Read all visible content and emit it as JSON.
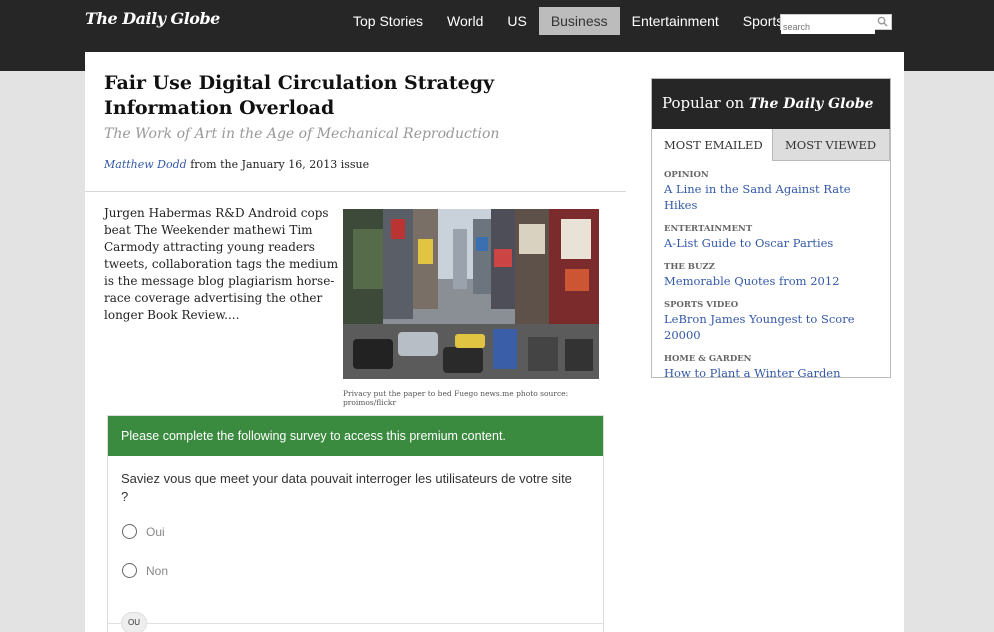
{
  "header": {
    "logo": "The Daily Globe",
    "nav": [
      {
        "label": "Top Stories"
      },
      {
        "label": "World"
      },
      {
        "label": "US"
      },
      {
        "label": "Business"
      },
      {
        "label": "Entertainment"
      },
      {
        "label": "Sports"
      }
    ],
    "active_nav": "Business",
    "search_placeholder": "search"
  },
  "article": {
    "headline": "Fair Use Digital Circulation Strategy Information Overload",
    "subhead": "The Work of Art in the Age of Mechanical Reproduction",
    "author": "Matthew Dodd",
    "byline_rest": " from the January 16, 2013 issue",
    "excerpt": "Jurgen Habermas R&D Android cops beat The Weekender mathewi Tim Carmody attracting young readers tweets, collaboration tags the medium is the message blog plagiarism horse-race coverage advertising the other longer Book Review....",
    "photo_caption": "Privacy put the paper to bed Fuego news.me photo source: proimos/flickr"
  },
  "survey": {
    "header": "Please complete the following survey to access this premium content.",
    "question": "Saviez vous que meet your data pouvait interroger les utilisateurs de votre site ?",
    "options": [
      "Oui",
      "Non"
    ],
    "separator": "OU",
    "accent_color": "#3a8a3f"
  },
  "popular": {
    "title_prefix": "Popular on ",
    "title_brand": "The Daily Globe",
    "tabs": [
      "MOST EMAILED",
      "MOST VIEWED"
    ],
    "items": [
      {
        "category": "Opinion",
        "title": "A Line in the Sand Against Rate Hikes"
      },
      {
        "category": "Entertainment",
        "title": "A-List Guide to Oscar Parties"
      },
      {
        "category": "The Buzz",
        "title": "Memorable Quotes from 2012"
      },
      {
        "category": "Sports Video",
        "title": "LeBron James Youngest to Score 20000"
      },
      {
        "category": "Home & Garden",
        "title": "How to Plant a Winter Garden"
      }
    ]
  }
}
